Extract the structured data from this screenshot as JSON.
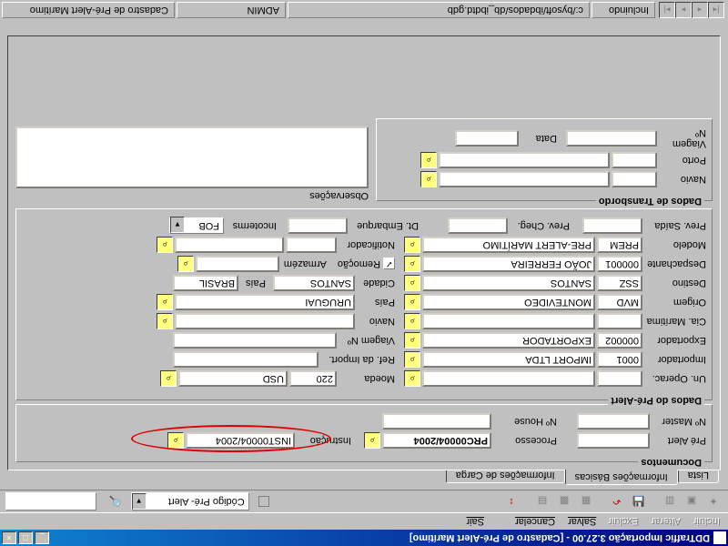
{
  "title": "DDTraffic Importação 3.27.00 - [Cadastro de Pré-Alert Marítimo]",
  "menu": {
    "incluir": "Incluir",
    "alterar": "Alterar",
    "excluir": "Excluir",
    "salvar": "Salvar",
    "cancelar": "Cancelar",
    "sair": "Sair"
  },
  "search": {
    "combo": "Código Pré- Alert"
  },
  "tabs": {
    "lista": "Lista",
    "basicas": "Informações Básicas",
    "carga": "Informações de Carga"
  },
  "documentos": {
    "title": "Documentos",
    "prealert_lbl": "Pré Alert",
    "prealert": "",
    "processo_lbl": "Processo",
    "processo": "PRC00004/2004",
    "instrucao_lbl": "Instrução",
    "instrucao": "INST00004/2004",
    "master_lbl": "Nº Master",
    "master": "",
    "house_lbl": "Nº House",
    "house": ""
  },
  "dados": {
    "title": "Dados do Pré-Alert",
    "unoperac_lbl": "Un. Operac.",
    "unoperac": "",
    "moeda_lbl": "Moeda",
    "moeda_code": "220",
    "moeda_name": "USD",
    "importador_lbl": "Importador",
    "importador_code": "0001",
    "importador_name": "IMPORT LTDA",
    "refimport_lbl": "Ref. da Import.",
    "refimport": "",
    "exportador_lbl": "Exportador",
    "exportador_code": "000002",
    "exportador_name": "EXPORTADOR",
    "viagem_lbl": "Viagem Nº",
    "viagem": "",
    "ciamaritima_lbl": "Cia. Marítima",
    "ciamaritima_code": "",
    "ciamaritima_name": "",
    "navio_lbl": "Navio",
    "navio": "",
    "origem_lbl": "Origem",
    "origem_code": "MVD",
    "origem_name": "MONTEVIDEO",
    "pais_lbl": "País",
    "pais": "URUGUAI",
    "destino_lbl": "Destino",
    "destino_code": "SSZ",
    "destino_name": "SANTOS",
    "cidade_lbl": "Cidade",
    "cidade": "SANTOS",
    "pais2_lbl": "País",
    "pais2": "BRASIL",
    "despachante_lbl": "Despachante",
    "despachante_code": "000001",
    "despachante_name": "JOÃO FERREIRA",
    "remocao_lbl": "Remoção",
    "armazem_lbl": "Armazém",
    "armazem": "",
    "modelo_lbl": "Modelo",
    "modelo_code": "PREM",
    "modelo_name": "PRE-ALERT MARÍTIMO",
    "notificador_lbl": "Notificador",
    "notificador": "",
    "prevsaida_lbl": "Prev. Saída",
    "prevsaida": "",
    "prevcheg_lbl": "Prev. Cheg.",
    "prevcheg": "",
    "dtembarque_lbl": "Dt. Embarque",
    "dtembarque": "",
    "incoterms_lbl": "Incoterms",
    "incoterms": "FOB"
  },
  "transbordo": {
    "title": "Dados de Transbordo",
    "navio_lbl": "Navio",
    "navio": "",
    "porto_lbl": "Porto",
    "porto": "",
    "viagem_lbl": "Viagem Nº",
    "viagem": "",
    "data_lbl": "Data",
    "data": ""
  },
  "obs": {
    "title": "Observações"
  },
  "status": {
    "mode": "Incluindo",
    "path": "c:/bysoft/ibdados/db_ibdtd.gdb",
    "user": "ADMIN",
    "screen": "Cadastro de Pré-Alert Marítimo"
  }
}
